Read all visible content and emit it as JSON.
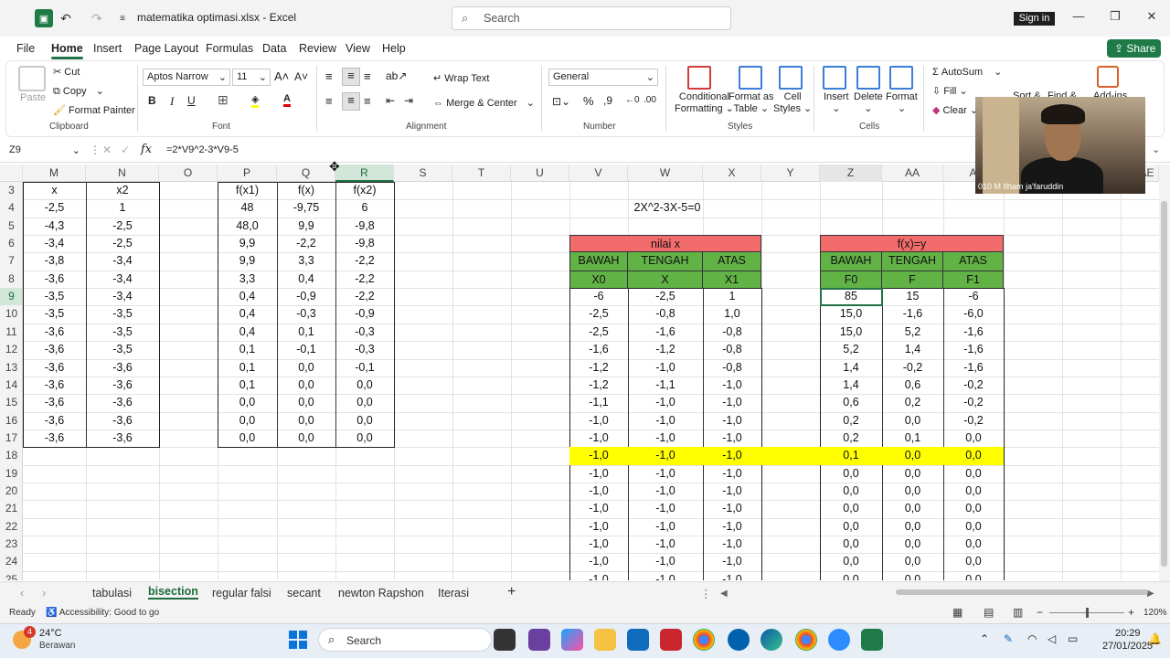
{
  "window": {
    "title": "matematika optimasi.xlsx  -  Excel",
    "search_placeholder": "Search",
    "signin": "Sign in"
  },
  "ribbon_tabs": [
    "File",
    "Home",
    "Insert",
    "Page Layout",
    "Formulas",
    "Data",
    "Review",
    "View",
    "Help"
  ],
  "share_label": "Share",
  "ribbon": {
    "clipboard": {
      "paste": "Paste",
      "cut": "Cut",
      "copy": "Copy",
      "format_painter": "Format Painter",
      "label": "Clipboard"
    },
    "font": {
      "name": "Aptos Narrow",
      "size": "11",
      "label": "Font"
    },
    "alignment": {
      "wrap": "Wrap Text",
      "merge": "Merge & Center",
      "label": "Alignment"
    },
    "number": {
      "format": "General",
      "label": "Number"
    },
    "styles": {
      "conditional": "Conditional",
      "conditional2": "Formatting",
      "format_as": "Format as",
      "table": "Table",
      "cell": "Cell",
      "styles": "Styles",
      "label": "Styles"
    },
    "cells": {
      "insert": "Insert",
      "delete": "Delete",
      "format": "Format",
      "label": "Cells"
    },
    "editing": {
      "autosum": "AutoSum",
      "fill": "Fill",
      "clear": "Clear",
      "sort": "Sort &",
      "find": "Find &",
      "addins": "Add-ins"
    }
  },
  "formula_bar": {
    "name_box": "Z9",
    "fx": "fx",
    "formula": "=2*V9^2-3*V9-5"
  },
  "columns": [
    "M",
    "N",
    "O",
    "P",
    "Q",
    "R",
    "S",
    "T",
    "U",
    "V",
    "W",
    "X",
    "Y",
    "Z",
    "AA",
    "A",
    "AE"
  ],
  "rows": [
    "3",
    "4",
    "5",
    "6",
    "7",
    "8",
    "9",
    "10",
    "11",
    "12",
    "13",
    "14",
    "15",
    "16",
    "17",
    "18",
    "19",
    "20",
    "21",
    "22",
    "23",
    "24",
    "25"
  ],
  "left_table": {
    "headers": [
      "x",
      "x2"
    ],
    "rows": [
      [
        "-2,5",
        "1"
      ],
      [
        "-4,3",
        "-2,5"
      ],
      [
        "-3,4",
        "-2,5"
      ],
      [
        "-3,8",
        "-3,4"
      ],
      [
        "-3,6",
        "-3,4"
      ],
      [
        "-3,5",
        "-3,4"
      ],
      [
        "-3,5",
        "-3,5"
      ],
      [
        "-3,6",
        "-3,5"
      ],
      [
        "-3,6",
        "-3,5"
      ],
      [
        "-3,6",
        "-3,6"
      ],
      [
        "-3,6",
        "-3,6"
      ],
      [
        "-3,6",
        "-3,6"
      ],
      [
        "-3,6",
        "-3,6"
      ],
      [
        "-3,6",
        "-3,6"
      ]
    ]
  },
  "mid_table": {
    "headers": [
      "f(x1)",
      "f(x)",
      "f(x2)"
    ],
    "rows": [
      [
        "48",
        "-9,75",
        "6"
      ],
      [
        "48,0",
        "9,9",
        "-9,8"
      ],
      [
        "9,9",
        "-2,2",
        "-9,8"
      ],
      [
        "9,9",
        "3,3",
        "-2,2"
      ],
      [
        "3,3",
        "0,4",
        "-2,2"
      ],
      [
        "0,4",
        "-0,9",
        "-2,2"
      ],
      [
        "0,4",
        "-0,3",
        "-0,9"
      ],
      [
        "0,4",
        "0,1",
        "-0,3"
      ],
      [
        "0,1",
        "-0,1",
        "-0,3"
      ],
      [
        "0,1",
        "0,0",
        "-0,1"
      ],
      [
        "0,1",
        "0,0",
        "0,0"
      ],
      [
        "0,0",
        "0,0",
        "0,0"
      ],
      [
        "0,0",
        "0,0",
        "0,0"
      ],
      [
        "0,0",
        "0,0",
        "0,0"
      ]
    ]
  },
  "equation": "2X^2-3X-5=0",
  "nilai_table": {
    "title": "nilai x",
    "headers": [
      "BAWAH",
      "TENGAH",
      "ATAS"
    ],
    "subheaders": [
      "X0",
      "X",
      "X1"
    ],
    "rows": [
      [
        "-6",
        "-2,5",
        "1"
      ],
      [
        "-2,5",
        "-0,8",
        "1,0"
      ],
      [
        "-2,5",
        "-1,6",
        "-0,8"
      ],
      [
        "-1,6",
        "-1,2",
        "-0,8"
      ],
      [
        "-1,2",
        "-1,0",
        "-0,8"
      ],
      [
        "-1,2",
        "-1,1",
        "-1,0"
      ],
      [
        "-1,1",
        "-1,0",
        "-1,0"
      ],
      [
        "-1,0",
        "-1,0",
        "-1,0"
      ],
      [
        "-1,0",
        "-1,0",
        "-1,0"
      ],
      [
        "-1,0",
        "-1,0",
        "-1,0"
      ],
      [
        "-1,0",
        "-1,0",
        "-1,0"
      ],
      [
        "-1,0",
        "-1,0",
        "-1,0"
      ],
      [
        "-1,0",
        "-1,0",
        "-1,0"
      ],
      [
        "-1,0",
        "-1,0",
        "-1,0"
      ],
      [
        "-1,0",
        "-1,0",
        "-1,0"
      ],
      [
        "-1,0",
        "-1,0",
        "-1,0"
      ],
      [
        "-1,0",
        "-1,0",
        "-1,0"
      ]
    ]
  },
  "fx_table": {
    "title": "f(x)=y",
    "headers": [
      "BAWAH",
      "TENGAH",
      "ATAS"
    ],
    "subheaders": [
      "F0",
      "F",
      "F1"
    ],
    "rows": [
      [
        "85",
        "15",
        "-6"
      ],
      [
        "15,0",
        "-1,6",
        "-6,0"
      ],
      [
        "15,0",
        "5,2",
        "-1,6"
      ],
      [
        "5,2",
        "1,4",
        "-1,6"
      ],
      [
        "1,4",
        "-0,2",
        "-1,6"
      ],
      [
        "1,4",
        "0,6",
        "-0,2"
      ],
      [
        "0,6",
        "0,2",
        "-0,2"
      ],
      [
        "0,2",
        "0,0",
        "-0,2"
      ],
      [
        "0,2",
        "0,1",
        "0,0"
      ],
      [
        "0,1",
        "0,0",
        "0,0"
      ],
      [
        "0,0",
        "0,0",
        "0,0"
      ],
      [
        "0,0",
        "0,0",
        "0,0"
      ],
      [
        "0,0",
        "0,0",
        "0,0"
      ],
      [
        "0,0",
        "0,0",
        "0,0"
      ],
      [
        "0,0",
        "0,0",
        "0,0"
      ],
      [
        "0,0",
        "0,0",
        "0,0"
      ],
      [
        "0,0",
        "0,0",
        "0,0"
      ]
    ]
  },
  "sheets": [
    "tabulasi",
    "bisection",
    "regular falsi",
    "secant",
    "newton Rapshon",
    "Iterasi"
  ],
  "active_sheet": "bisection",
  "status": {
    "ready": "Ready",
    "accessibility": "Accessibility: Good to go",
    "zoom": "120%"
  },
  "taskbar": {
    "temp": "24°C",
    "weather": "Berawan",
    "search": "Search",
    "time": "20:29",
    "date": "27/01/2025",
    "badge": "4"
  },
  "webcam_label": "010 M Ilham ja'faruddin",
  "colors": {
    "excel_green": "#217346",
    "header_red": "#f26c6c",
    "header_green": "#62b346",
    "highlight": "#ffff00"
  }
}
